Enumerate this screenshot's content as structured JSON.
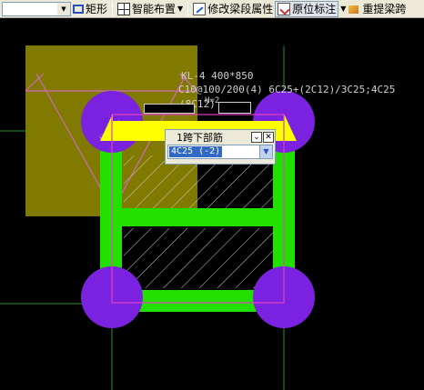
{
  "toolbar": {
    "combo_value": "",
    "rect_label": "矩形",
    "smart_layout_label": "智能布置",
    "modify_beam_label": "修改梁段属性",
    "original_mark_label": "原位标注",
    "re_extract_label": "重提梁跨"
  },
  "annotation": {
    "beam_name": "KL-4  400*850",
    "stirrup": "C10@100/200(4)  6C25+(2C12)/3C25;4C25",
    "partial": "(8C12)",
    "small_note": "H=2"
  },
  "span_editor": {
    "title": "1跨下部筋",
    "value": "4C25 (-2)"
  },
  "colors": {
    "column": "#7a22e0",
    "beam": "#22e000",
    "highlight_beam": "#ffff00",
    "slab": "#807a00",
    "selection": "#e040c0",
    "axis": "#2a8f2a"
  }
}
